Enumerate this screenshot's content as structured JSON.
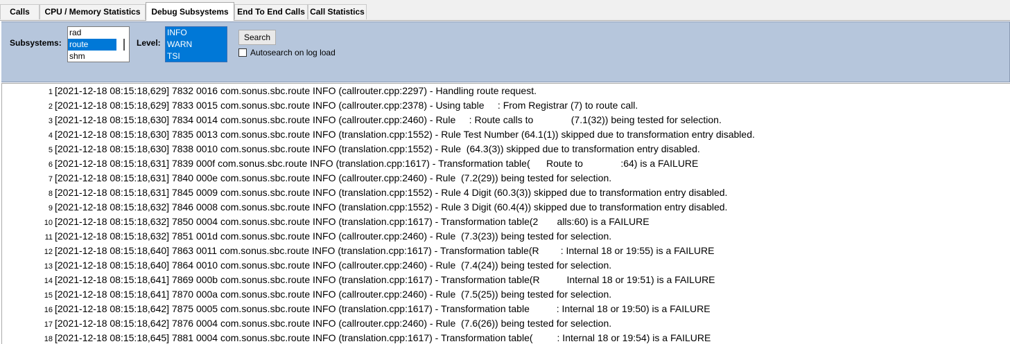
{
  "tabs": [
    {
      "label": "Calls",
      "active": false
    },
    {
      "label": "CPU / Memory Statistics",
      "active": false
    },
    {
      "label": "Debug Subsystems",
      "active": true
    },
    {
      "label": "End To End Calls",
      "active": false
    },
    {
      "label": "Call Statistics",
      "active": false
    }
  ],
  "controls": {
    "subsystems_label": "Subsystems:",
    "subsystems": [
      {
        "label": "rad",
        "selected": false
      },
      {
        "label": "route",
        "selected": true
      },
      {
        "label": "shm",
        "selected": false
      }
    ],
    "level_label": "Level:",
    "levels": [
      {
        "label": "INFO",
        "selected": true
      },
      {
        "label": "WARN",
        "selected": true
      },
      {
        "label": "TSI",
        "selected": true
      }
    ],
    "search_label": "Search",
    "autosearch_label": "Autosearch on log load",
    "autosearch_checked": false
  },
  "colors": {
    "panel_bg": "#b6c6dc",
    "selection": "#0078d7"
  },
  "log_lines": [
    {
      "n": "1",
      "text": "[2021-12-18 08:15:18,629] 7832 0016 com.sonus.sbc.route INFO (callrouter.cpp:2297) - Handling route request."
    },
    {
      "n": "2",
      "text": "[2021-12-18 08:15:18,629] 7833 0015 com.sonus.sbc.route INFO (callrouter.cpp:2378) - Using table     : From Registrar (7) to route call."
    },
    {
      "n": "3",
      "text": "[2021-12-18 08:15:18,630] 7834 0014 com.sonus.sbc.route INFO (callrouter.cpp:2460) - Rule     : Route calls to              (7.1(32)) being tested for selection."
    },
    {
      "n": "4",
      "text": "[2021-12-18 08:15:18,630] 7835 0013 com.sonus.sbc.route INFO (translation.cpp:1552) - Rule Test Number (64.1(1)) skipped due to transformation entry disabled."
    },
    {
      "n": "5",
      "text": "[2021-12-18 08:15:18,630] 7838 0010 com.sonus.sbc.route INFO (translation.cpp:1552) - Rule  (64.3(3)) skipped due to transformation entry disabled."
    },
    {
      "n": "6",
      "text": "[2021-12-18 08:15:18,631] 7839 000f com.sonus.sbc.route INFO (translation.cpp:1617) - Transformation table(      Route to              :64) is a FAILURE"
    },
    {
      "n": "7",
      "text": "[2021-12-18 08:15:18,631] 7840 000e com.sonus.sbc.route INFO (callrouter.cpp:2460) - Rule  (7.2(29)) being tested for selection."
    },
    {
      "n": "8",
      "text": "[2021-12-18 08:15:18,631] 7845 0009 com.sonus.sbc.route INFO (translation.cpp:1552) - Rule 4 Digit (60.3(3)) skipped due to transformation entry disabled."
    },
    {
      "n": "9",
      "text": "[2021-12-18 08:15:18,632] 7846 0008 com.sonus.sbc.route INFO (translation.cpp:1552) - Rule 3 Digit (60.4(4)) skipped due to transformation entry disabled."
    },
    {
      "n": "10",
      "text": "[2021-12-18 08:15:18,632] 7850 0004 com.sonus.sbc.route INFO (translation.cpp:1617) - Transformation table(2       alls:60) is a FAILURE"
    },
    {
      "n": "11",
      "text": "[2021-12-18 08:15:18,632] 7851 001d com.sonus.sbc.route INFO (callrouter.cpp:2460) - Rule  (7.3(23)) being tested for selection."
    },
    {
      "n": "12",
      "text": "[2021-12-18 08:15:18,640] 7863 0011 com.sonus.sbc.route INFO (translation.cpp:1617) - Transformation table(R        : Internal 18 or 19:55) is a FAILURE"
    },
    {
      "n": "13",
      "text": "[2021-12-18 08:15:18,640] 7864 0010 com.sonus.sbc.route INFO (callrouter.cpp:2460) - Rule  (7.4(24)) being tested for selection."
    },
    {
      "n": "14",
      "text": "[2021-12-18 08:15:18,641] 7869 000b com.sonus.sbc.route INFO (translation.cpp:1617) - Transformation table(R          Internal 18 or 19:51) is a FAILURE"
    },
    {
      "n": "15",
      "text": "[2021-12-18 08:15:18,641] 7870 000a com.sonus.sbc.route INFO (callrouter.cpp:2460) - Rule  (7.5(25)) being tested for selection."
    },
    {
      "n": "16",
      "text": "[2021-12-18 08:15:18,642] 7875 0005 com.sonus.sbc.route INFO (translation.cpp:1617) - Transformation table          : Internal 18 or 19:50) is a FAILURE"
    },
    {
      "n": "17",
      "text": "[2021-12-18 08:15:18,642] 7876 0004 com.sonus.sbc.route INFO (callrouter.cpp:2460) - Rule  (7.6(26)) being tested for selection."
    },
    {
      "n": "18",
      "text": "[2021-12-18 08:15:18,645] 7881 0004 com.sonus.sbc.route INFO (translation.cpp:1617) - Transformation table(         : Internal 18 or 19:54) is a FAILURE"
    }
  ]
}
